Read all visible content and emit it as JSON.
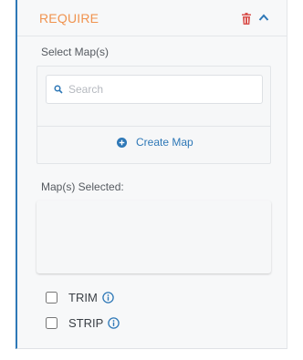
{
  "section": {
    "title": "REQUIRE",
    "icons": {
      "delete": "trash-icon",
      "collapse": "chevron-up-icon"
    }
  },
  "maps": {
    "select_label": "Select Map(s)",
    "search_placeholder": "Search",
    "search_value": "",
    "create_label": "Create Map",
    "selected_label": "Map(s) Selected:"
  },
  "options": [
    {
      "label": "TRIM",
      "checked": false
    },
    {
      "label": "STRIP",
      "checked": false
    }
  ],
  "colors": {
    "accent": "#2e78b7",
    "title": "#f0934f",
    "delete": "#d9534f"
  }
}
